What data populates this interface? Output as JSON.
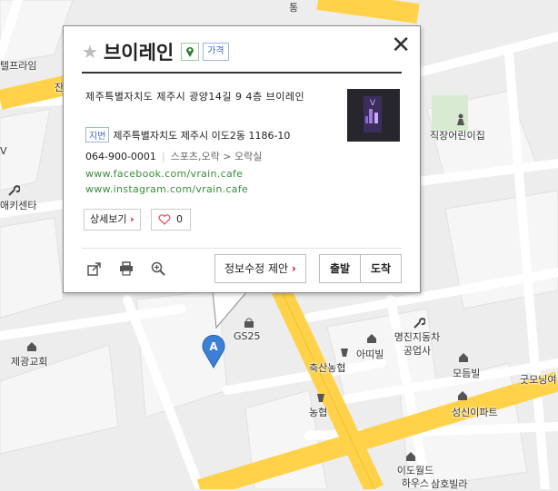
{
  "popup": {
    "place_name": "브이레인",
    "price_badge": "가격",
    "road_address": "제주특별자치도 제주시 광양14길 9 4층 브이레인",
    "jibun_badge": "지번",
    "jibun_address": "제주특별자치도 제주시 이도2동 1186-10",
    "phone": "064-900-0001",
    "category": "스포츠,오락 > 오락실",
    "links": [
      "www.facebook.com/vrain.cafe",
      "www.instagram.com/vrain.cafe"
    ],
    "detail_button": "상세보기",
    "like_count": "0",
    "edit_button": "정보수정 제안",
    "depart_button": "출발",
    "arrive_button": "도착",
    "close_glyph": "✕",
    "star_glyph": "★",
    "arrow_glyph": "›"
  },
  "map": {
    "marker_letter": "A",
    "labels": [
      "텔프라임",
      "잔",
      "V",
      "애키센타",
      "직장어린이집",
      "GS25",
      "제광교회",
      "아띠빌",
      "명진지동차 공업사",
      "축산농협",
      "모듬빌",
      "굿모닝여",
      "농협",
      "성신이파트",
      "이도월드 하우스",
      "삼호빌라",
      "통"
    ]
  },
  "colors": {
    "road_major": "#ffd24a",
    "road_minor": "#ffffff",
    "map_bg": "#ededed",
    "marker": "#3c7fd6",
    "link": "#3a8d3a",
    "accent_red": "#d0021b"
  },
  "icons": [
    "star-icon",
    "pin-icon",
    "close-icon",
    "share-icon",
    "print-icon",
    "zoom-icon",
    "heart-icon",
    "wrench-icon",
    "house-icon",
    "bag-icon",
    "cup-icon"
  ]
}
